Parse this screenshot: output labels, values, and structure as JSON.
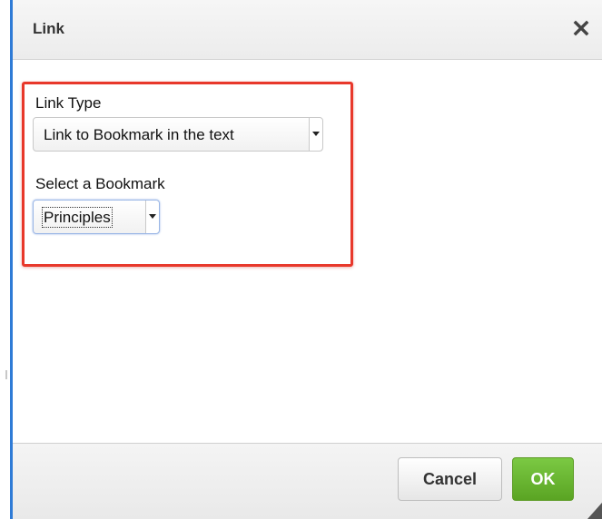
{
  "dialog": {
    "title": "Link"
  },
  "form": {
    "link_type_label": "Link Type",
    "link_type_value": "Link to Bookmark in the text",
    "bookmark_label": "Select a Bookmark",
    "bookmark_value": "Principles"
  },
  "footer": {
    "cancel_label": "Cancel",
    "ok_label": "OK"
  },
  "colors": {
    "highlight_border": "#e8382b",
    "dialog_accent": "#2f7bd6",
    "ok_button": "#6cb833"
  },
  "icons": {
    "close": "close-icon",
    "dropdown": "caret-down-icon",
    "resize": "resize-grip-icon"
  }
}
